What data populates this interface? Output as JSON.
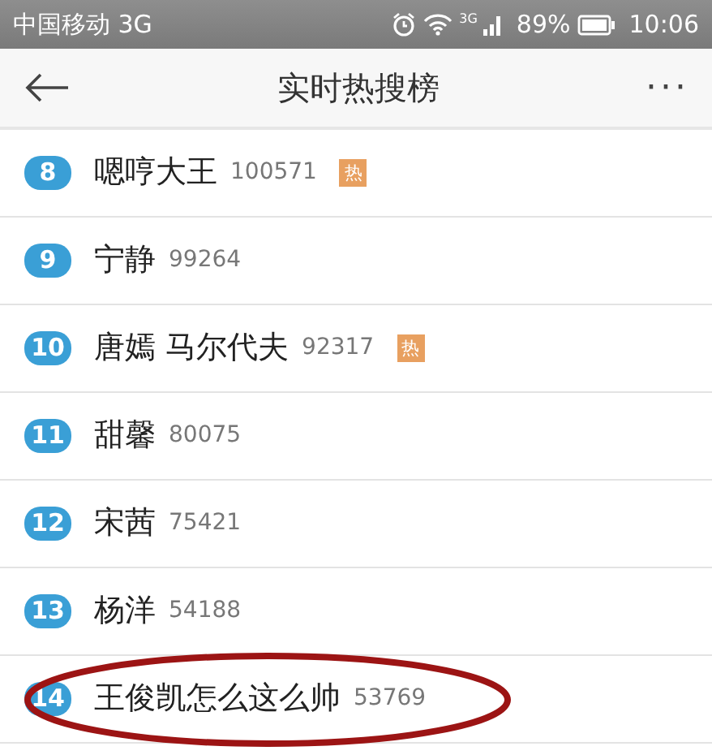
{
  "status_bar": {
    "carrier": "中国移动 3G",
    "network": "3G",
    "battery": "89%",
    "time": "10:06"
  },
  "header": {
    "title": "实时热搜榜",
    "more": "···"
  },
  "rows": [
    {
      "rank": "8",
      "name": "嗯哼大王",
      "count": "100571",
      "tag": "热"
    },
    {
      "rank": "9",
      "name": "宁静",
      "count": "99264"
    },
    {
      "rank": "10",
      "name": "唐嫣 马尔代夫",
      "count": "92317",
      "tag": "热"
    },
    {
      "rank": "11",
      "name": "甜馨",
      "count": "80075"
    },
    {
      "rank": "12",
      "name": "宋茜",
      "count": "75421"
    },
    {
      "rank": "13",
      "name": "杨洋",
      "count": "54188"
    },
    {
      "rank": "14",
      "name": "王俊凯怎么这么帅",
      "count": "53769",
      "circled": true
    }
  ]
}
